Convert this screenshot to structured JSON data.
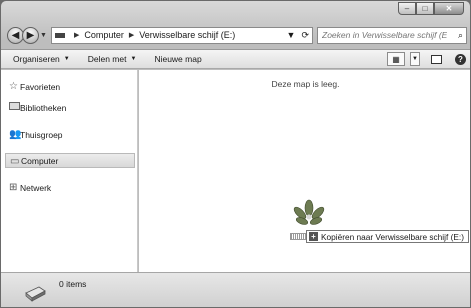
{
  "window": {
    "caption": {
      "minimize": "–",
      "maximize": "□",
      "close": "✕"
    }
  },
  "nav": {
    "back_icon": "back-arrow-icon",
    "forward_icon": "forward-arrow-icon",
    "breadcrumb": [
      "Computer",
      "Verwisselbare schijf (E:)"
    ],
    "refresh_glyph": "⟳"
  },
  "search": {
    "placeholder": "Zoeken in Verwisselbare schijf (E:)"
  },
  "toolbar": {
    "organize_label": "Organiseren",
    "share_label": "Delen met",
    "new_folder_label": "Nieuwe map",
    "help_label": "?"
  },
  "sidebar": {
    "items": [
      {
        "label": "Favorieten",
        "icon": "star-icon",
        "selected": false
      },
      {
        "label": "Bibliotheken",
        "icon": "library-icon",
        "selected": false
      },
      {
        "label": "Thuisgroep",
        "icon": "homegroup-icon",
        "selected": false
      },
      {
        "label": "Computer",
        "icon": "computer-icon",
        "selected": true
      },
      {
        "label": "Netwerk",
        "icon": "network-icon",
        "selected": false
      }
    ]
  },
  "content": {
    "empty_message": "Deze map is leeg.",
    "drag_tooltip": "Kopiëren naar Verwisselbare schijf (E:)"
  },
  "details": {
    "item_count": "0 items"
  }
}
